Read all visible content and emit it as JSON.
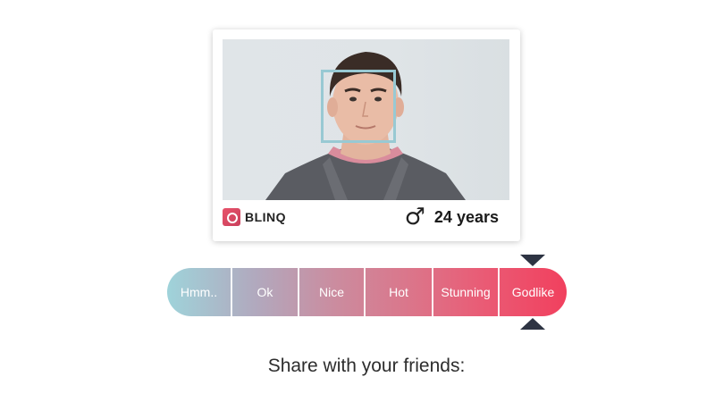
{
  "card": {
    "brand": "BLINQ",
    "gender_symbol": "♂",
    "age": "24 years"
  },
  "rating": {
    "options": [
      "Hmm..",
      "Ok",
      "Nice",
      "Hot",
      "Stunning",
      "Godlike"
    ],
    "selected": "Godlike"
  },
  "share": {
    "label": "Share with your friends:"
  }
}
